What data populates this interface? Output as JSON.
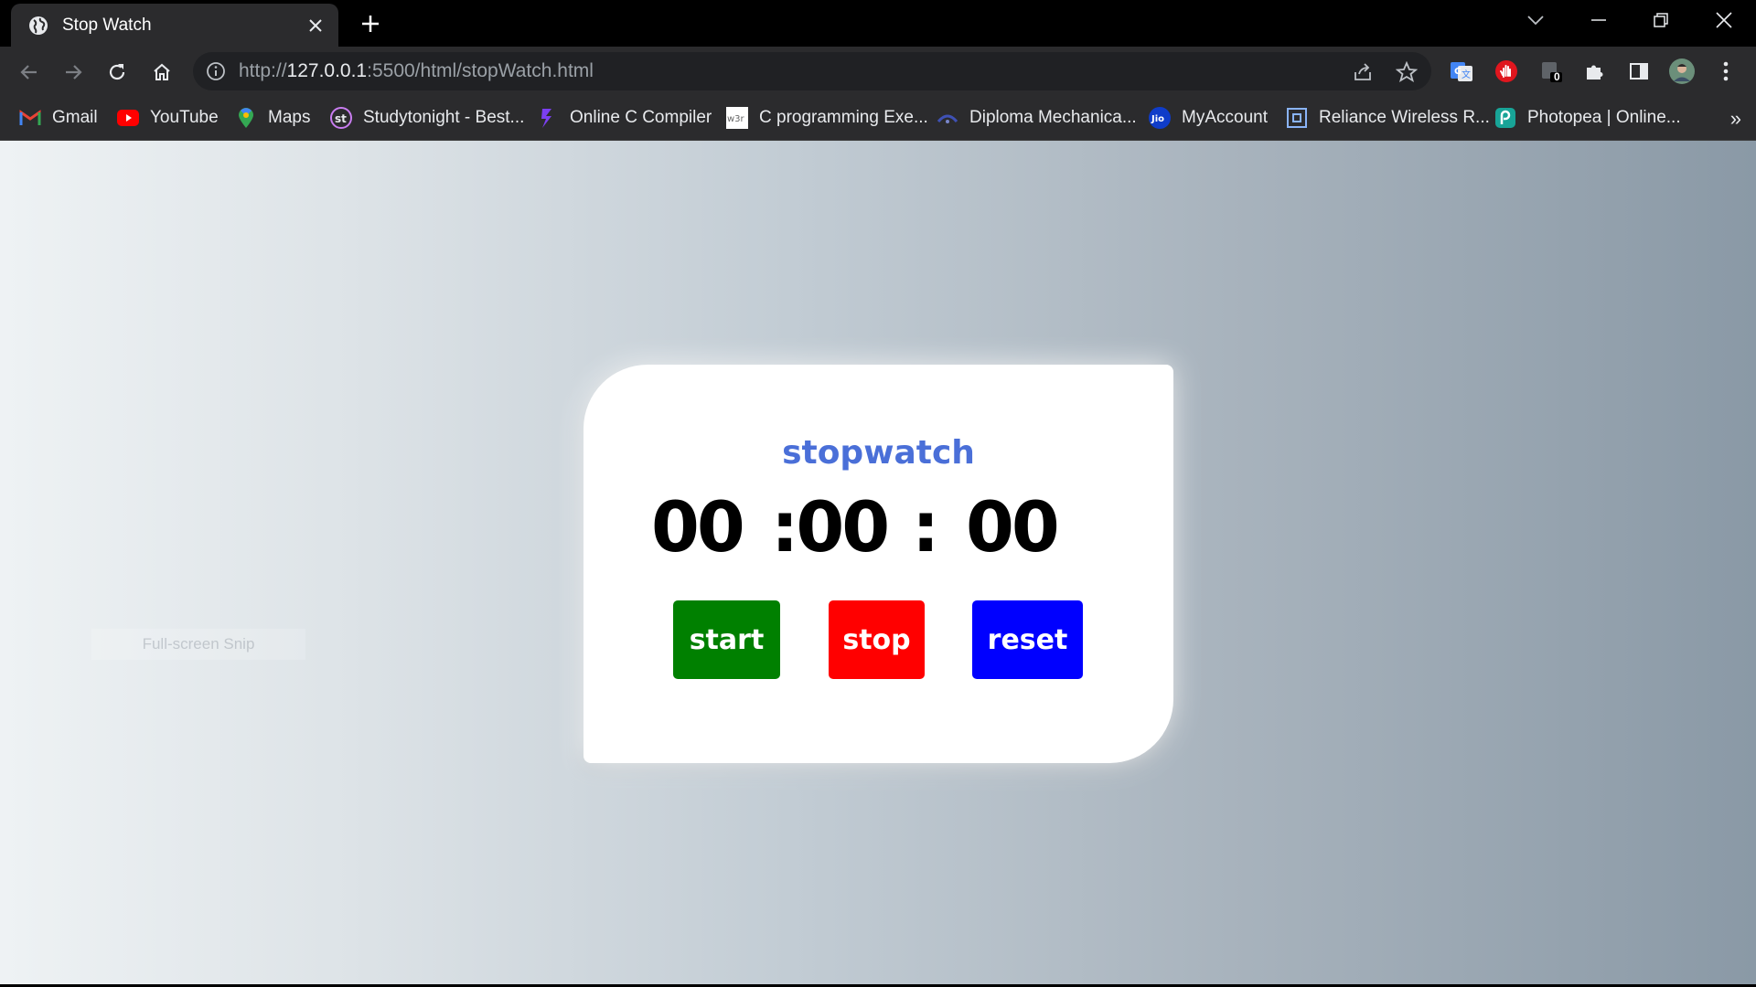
{
  "browser": {
    "tab_title": "Stop Watch",
    "url_scheme": "http://",
    "url_host": "127.0.0.1",
    "url_rest": ":5500/html/stopWatch.html",
    "extension_badge": "0",
    "bookmarks": [
      {
        "label": "Gmail",
        "icon": "gmail-icon"
      },
      {
        "label": "YouTube",
        "icon": "youtube-icon"
      },
      {
        "label": "Maps",
        "icon": "maps-icon"
      },
      {
        "label": "Studytonight - Best...",
        "icon": "studytonight-icon"
      },
      {
        "label": "Online C Compiler",
        "icon": "compiler-icon"
      },
      {
        "label": "C programming Exe...",
        "icon": "w3r-icon"
      },
      {
        "label": "Diploma Mechanica...",
        "icon": "diploma-icon"
      },
      {
        "label": "MyAccount",
        "icon": "jio-icon"
      },
      {
        "label": "Reliance Wireless R...",
        "icon": "reliance-icon"
      },
      {
        "label": "Photopea | Online...",
        "icon": "photopea-icon"
      }
    ],
    "more_bookmarks": "»"
  },
  "page": {
    "ghost_text": "Full-screen Snip",
    "stopwatch": {
      "title": "stopwatch",
      "hours": "00",
      "minutes": ":00",
      "separator": ":",
      "seconds": "00",
      "start_label": "start",
      "stop_label": "stop",
      "reset_label": "reset"
    }
  },
  "colors": {
    "title": "#4a6fd8",
    "start": "#008000",
    "stop": "#ff0000",
    "reset": "#0000ff"
  }
}
